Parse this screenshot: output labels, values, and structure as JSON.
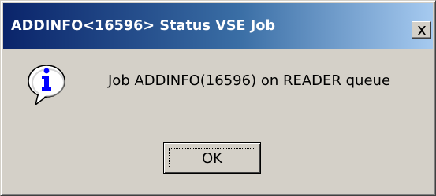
{
  "window": {
    "title": "ADDINFO<16596> Status VSE Job",
    "close_label": "Close"
  },
  "dialog": {
    "icon": "information-icon",
    "message": "Job ADDINFO(16596) on READER queue",
    "ok_label": "OK"
  },
  "colors": {
    "titlebar_start": "#0a246a",
    "titlebar_end": "#a6caf0",
    "face": "#d4d0c8",
    "icon_blue": "#0000ff"
  }
}
